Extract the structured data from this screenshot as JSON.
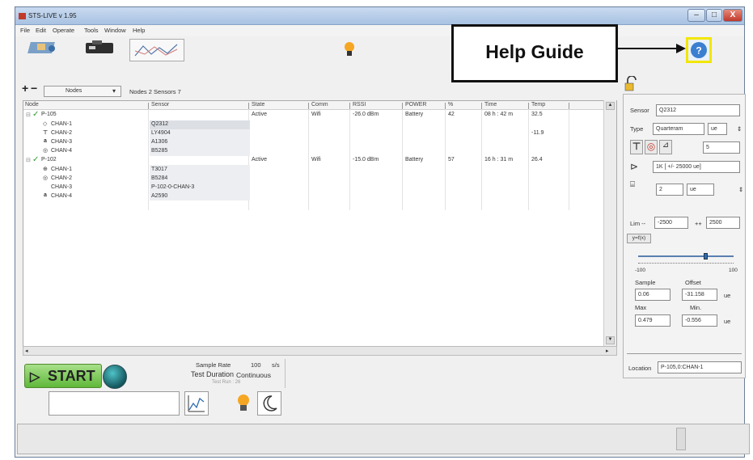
{
  "window": {
    "title": "STS-LIVE v 1.95",
    "controls": [
      "–",
      "□",
      "X"
    ]
  },
  "menu": [
    "File",
    "Edit",
    "Operate",
    "Tools",
    "Window",
    "Help"
  ],
  "callout": {
    "text": "Help Guide"
  },
  "node_toolbar": {
    "add": "+",
    "remove": "−",
    "view_selected": "Nodes",
    "summary": "Nodes 2  Sensors 7"
  },
  "table": {
    "columns": [
      "Node",
      "Sensor",
      "State",
      "Comm",
      "RSSI",
      "POWER",
      "%",
      "Time",
      "Temp"
    ],
    "rows": [
      {
        "node": "P-105",
        "sensor": "",
        "state": "Active",
        "comm": "Wifi",
        "rssi": "-26.0 dBm",
        "power": "Battery",
        "pct": "42",
        "time": "08 h : 42 m",
        "temp": "32.5"
      },
      {
        "node": "CHAN-1",
        "sensor": "Q2312",
        "state": "",
        "comm": "",
        "rssi": "",
        "power": "",
        "pct": "",
        "time": "",
        "temp": ""
      },
      {
        "node": "CHAN-2",
        "sensor": "LY4904",
        "state": "",
        "comm": "",
        "rssi": "",
        "power": "",
        "pct": "",
        "time": "",
        "temp": "-11.9"
      },
      {
        "node": "CHAN-3",
        "sensor": "A1306",
        "state": "",
        "comm": "",
        "rssi": "",
        "power": "",
        "pct": "",
        "time": "",
        "temp": ""
      },
      {
        "node": "CHAN-4",
        "sensor": "B5285",
        "state": "",
        "comm": "",
        "rssi": "",
        "power": "",
        "pct": "",
        "time": "",
        "temp": ""
      },
      {
        "node": "P-102",
        "sensor": "",
        "state": "Active",
        "comm": "Wifi",
        "rssi": "-15.0 dBm",
        "power": "Battery",
        "pct": "57",
        "time": "16 h : 31 m",
        "temp": "26.4"
      },
      {
        "node": "CHAN-1",
        "sensor": "T3017",
        "state": "",
        "comm": "",
        "rssi": "",
        "power": "",
        "pct": "",
        "time": "",
        "temp": ""
      },
      {
        "node": "CHAN-2",
        "sensor": "B5284",
        "state": "",
        "comm": "",
        "rssi": "",
        "power": "",
        "pct": "",
        "time": "",
        "temp": ""
      },
      {
        "node": "CHAN-3",
        "sensor": "P-102-0-CHAN-3",
        "state": "",
        "comm": "",
        "rssi": "",
        "power": "",
        "pct": "",
        "time": "",
        "temp": ""
      },
      {
        "node": "CHAN-4",
        "sensor": "A2590",
        "state": "",
        "comm": "",
        "rssi": "",
        "power": "",
        "pct": "",
        "time": "",
        "temp": ""
      }
    ]
  },
  "sensor_panel": {
    "sensor_label": "Sensor",
    "sensor_value": "Q2312",
    "type_label": "Type",
    "type_value": "Quarteram",
    "unit_value": "ue",
    "gain_value": "5",
    "range_value": "1K  [ +/- 25000 ue]",
    "decimals_value": "2",
    "decimals_unit": "ue",
    "lim_label": "Lim --",
    "lim_low": "-2500",
    "lim_high_label": "++",
    "lim_high": "2500",
    "yzoom_label": "y=f(x)",
    "slider_min": "-100",
    "slider_max": "100",
    "slider_position": 0.72,
    "sample_label": "Sample",
    "sample_value": "0.06",
    "offset_label": "Offset",
    "offset_value": "-31.158",
    "offset_unit": "ue",
    "max_label": "Max",
    "max_value": "0.479",
    "min_label": "Min.",
    "min_value": "-0.556",
    "min_unit": "ue",
    "location_label": "Location",
    "location_value": "P-105,0:CHAN-1"
  },
  "bottom": {
    "start_label": "START",
    "sample_rate_label": "Sample Rate",
    "sample_rate_value": "100",
    "sample_rate_unit": "s/s",
    "duration_label": "Test Duration",
    "duration_value": "Continuous",
    "test_run_label": "Test Run : 26"
  },
  "colors": {
    "callout_highlight": "#f2e600",
    "start_green": "#5fb83a",
    "check_green": "#2e9d2e"
  }
}
